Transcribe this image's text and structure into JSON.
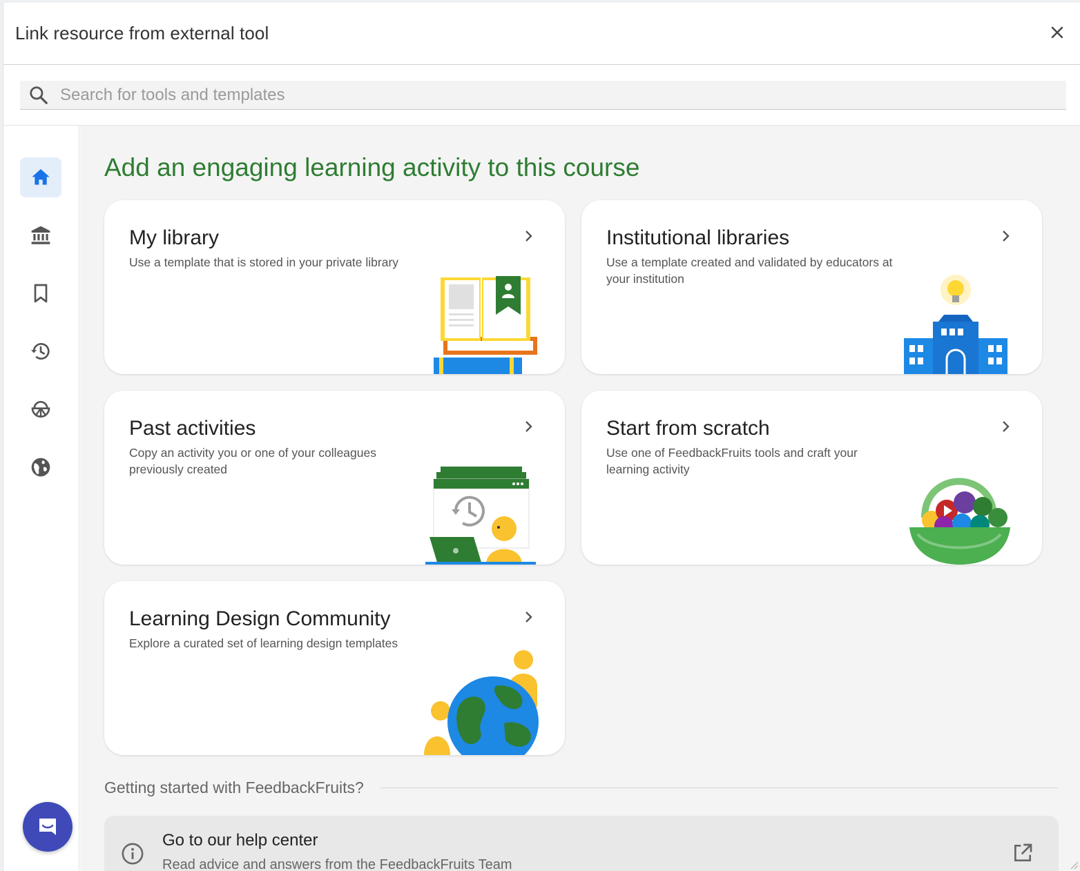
{
  "dialog": {
    "title": "Link resource from external tool",
    "close_label": "×"
  },
  "search": {
    "placeholder": "Search for tools and templates",
    "value": ""
  },
  "sidebar": {
    "items": [
      {
        "icon": "home-icon",
        "active": true
      },
      {
        "icon": "institution-icon",
        "active": false
      },
      {
        "icon": "bookmark-icon",
        "active": false
      },
      {
        "icon": "history-icon",
        "active": false
      },
      {
        "icon": "basket-icon",
        "active": false
      },
      {
        "icon": "globe-icon",
        "active": false
      }
    ]
  },
  "main": {
    "heading": "Add an engaging learning activity to this course",
    "cards": [
      {
        "title": "My library",
        "description": "Use a template that is stored in your private library"
      },
      {
        "title": "Institutional libraries",
        "description": "Use a template created and validated by educators at your institution"
      },
      {
        "title": "Past activities",
        "description": "Copy an activity you or one of your colleagues previously created"
      },
      {
        "title": "Start from scratch",
        "description": "Use one of FeedbackFruits tools and craft your learning activity"
      },
      {
        "title": "Learning Design Community",
        "description": "Explore a curated set of learning design templates"
      }
    ],
    "getting_started": "Getting started with FeedbackFruits?",
    "help": {
      "title": "Go to our help center",
      "subtitle": "Read advice and answers from the FeedbackFruits Team"
    }
  },
  "colors": {
    "accent_green": "#2e7d32",
    "active_nav_bg": "#e4eefb",
    "nav_icon_active": "#1a73e8",
    "chat_bubble": "#3f4ab8"
  }
}
